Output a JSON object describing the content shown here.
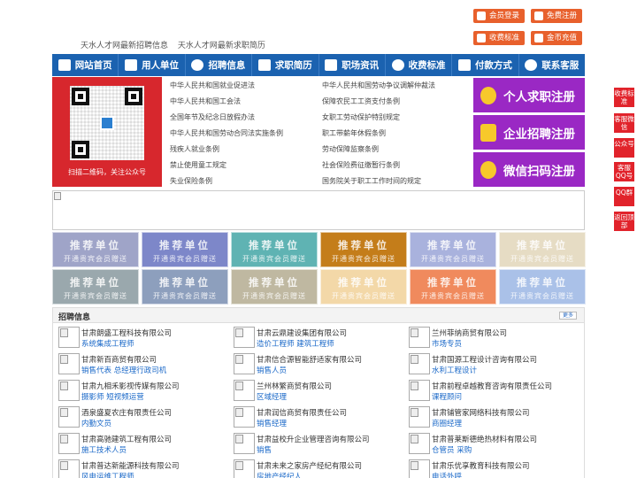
{
  "top_links": [
    "天水人才网最新招聘信息",
    "天水人才网最新求职简历"
  ],
  "top_buttons": [
    {
      "label": "会员登录",
      "icon": "user-icon"
    },
    {
      "label": "免费注册",
      "icon": "register-icon"
    },
    {
      "label": "收费标准",
      "icon": "yen-icon"
    },
    {
      "label": "金币充值",
      "icon": "coin-icon"
    }
  ],
  "nav": [
    {
      "label": "网站首页",
      "icon": "home-icon"
    },
    {
      "label": "用人单位",
      "icon": "building-icon"
    },
    {
      "label": "招聘信息",
      "icon": "megaphone-icon"
    },
    {
      "label": "求职简历",
      "icon": "resume-icon"
    },
    {
      "label": "职场资讯",
      "icon": "news-icon"
    },
    {
      "label": "收费标准",
      "icon": "yen-icon"
    },
    {
      "label": "付款方式",
      "icon": "wallet-icon"
    },
    {
      "label": "联系客服",
      "icon": "phone-icon"
    }
  ],
  "qr_caption": "扫描二维码，关注公众号",
  "laws_left": [
    "中华人民共和国就业促进法",
    "中华人民共和国工会法",
    "全国年节及纪念日放假办法",
    "中华人民共和国劳动合同法实施条例",
    "残疾人就业条例",
    "禁止使用童工规定",
    "失业保险条例"
  ],
  "laws_right": [
    "中华人民共和国劳动争议调解仲裁法",
    "保障农民工工资支付条例",
    "女职工劳动保护特别规定",
    "职工带薪年休假条例",
    "劳动保障监察条例",
    "社会保险费征缴暂行条例",
    "国务院关于职工工作时间的规定"
  ],
  "register_buttons": [
    {
      "label": "个人求职注册",
      "icon": "person-icon"
    },
    {
      "label": "企业招聘注册",
      "icon": "company-icon"
    },
    {
      "label": "微信扫码注册",
      "icon": "wechat-icon"
    }
  ],
  "tile_title": "推荐单位",
  "tile_subtitle": "开通贵宾会员赠送",
  "tile_colors": [
    "#9fa4c8",
    "#7d87c9",
    "#5fb3b3",
    "#c47d1a",
    "#a9b2dd",
    "#e6dcc4",
    "#9aa8ad",
    "#8d9fbd",
    "#bfb8a1",
    "#f3d8a8",
    "#f08a5d",
    "#aac1e8"
  ],
  "jobs_title": "招聘信息",
  "jobs_more": "更多",
  "jobs": [
    [
      {
        "company": "甘肃朗盛工程科技有限公司",
        "positions": "系统集成工程师"
      },
      {
        "company": "甘肃新百商贸有限公司",
        "positions": "销售代表 总经理行政司机"
      },
      {
        "company": "甘肃九相禾影视传媒有限公司",
        "positions": "摄影师 短视频运营"
      },
      {
        "company": "酒泉盛夏农庄有限责任公司",
        "positions": "内勤文员"
      },
      {
        "company": "甘肃高驰建筑工程有限公司",
        "positions": "施工技术人员"
      },
      {
        "company": "甘肃普达新能源科技有限公司",
        "positions": "风电运维工程师"
      }
    ],
    [
      {
        "company": "甘肃云鼎建设集团有限公司",
        "positions": "造价工程师 建筑工程师"
      },
      {
        "company": "甘肃信合源智能舒适家有限公司",
        "positions": "销售人员"
      },
      {
        "company": "兰州林繁商贸有限公司",
        "positions": "区域经理"
      },
      {
        "company": "甘肃润信商贸有限责任公司",
        "positions": "销售经理"
      },
      {
        "company": "甘肃益校升企业管理咨询有限公司",
        "positions": "销售"
      },
      {
        "company": "甘肃未来之家房产经纪有限公司",
        "positions": "房地产经纪人"
      }
    ],
    [
      {
        "company": "兰州菲纳商贸有限公司",
        "positions": "市场专员"
      },
      {
        "company": "甘肃国源工程设计咨询有限公司",
        "positions": "水利工程设计"
      },
      {
        "company": "甘肃前程卓越教育咨询有限责任公司",
        "positions": "课程顾问"
      },
      {
        "company": "甘肃铺管家网络科技有限公司",
        "positions": "商圈经理"
      },
      {
        "company": "甘肃普莱斯德绝热材料有限公司",
        "positions": "仓管员 采购"
      },
      {
        "company": "甘肃乐优享教育科技有限公司",
        "positions": "电话外呼"
      }
    ]
  ],
  "float_bar": [
    "收费标准",
    "客服微信",
    "公众号",
    "客服QQ号",
    "QQ群",
    "返回顶部"
  ]
}
